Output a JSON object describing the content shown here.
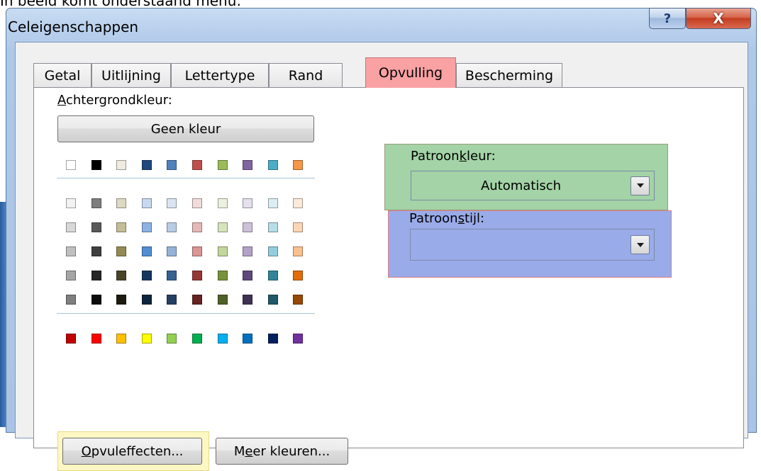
{
  "caption": "In beeld komt onderstaand menu:",
  "window": {
    "title": "Celeigenschappen",
    "help_label": "?",
    "close_label": "X"
  },
  "tabs": [
    {
      "label": "Getal",
      "active": false
    },
    {
      "label": "Uitlijning",
      "active": false
    },
    {
      "label": "Lettertype",
      "active": false
    },
    {
      "label": "Rand",
      "active": false
    },
    {
      "label": "Opvulling",
      "active": true
    },
    {
      "label": "Bescherming",
      "active": false
    }
  ],
  "background": {
    "label_accel": "A",
    "label_rest": "chtergrondkleur:",
    "no_color_button": "Geen kleur",
    "palette_top": [
      "#ffffff",
      "#000000",
      "#eeece1",
      "#1f497d",
      "#4f81bd",
      "#c0504d",
      "#9bbb59",
      "#8064a2",
      "#4bacc6",
      "#f79646"
    ],
    "palette_tints": [
      [
        "#f2f2f2",
        "#7f7f7f",
        "#ddd9c3",
        "#c6d9f0",
        "#dbe5f1",
        "#f2dcdb",
        "#ebf1dd",
        "#e5e0ec",
        "#dbeef3",
        "#fdeada"
      ],
      [
        "#d8d8d8",
        "#595959",
        "#c4bd97",
        "#8db3e2",
        "#b8cce4",
        "#e5b9b7",
        "#d7e3bc",
        "#ccc1d9",
        "#b7dde8",
        "#fbd5b5"
      ],
      [
        "#bfbfbf",
        "#3f3f3f",
        "#938953",
        "#548dd4",
        "#95b3d7",
        "#d99694",
        "#c3d69b",
        "#b2a2c7",
        "#92cddc",
        "#fac08f"
      ],
      [
        "#a5a5a5",
        "#262626",
        "#494429",
        "#17365d",
        "#366092",
        "#953734",
        "#76923c",
        "#5f497a",
        "#31859b",
        "#e36c09"
      ],
      [
        "#7f7f7f",
        "#0c0c0c",
        "#1d1b10",
        "#0f243e",
        "#244061",
        "#632423",
        "#4f6128",
        "#3f3151",
        "#205867",
        "#974806"
      ]
    ],
    "palette_standard": [
      "#c00000",
      "#ff0000",
      "#ffc000",
      "#ffff00",
      "#92d050",
      "#00b050",
      "#00b0f0",
      "#0070c0",
      "#002060",
      "#7030a0"
    ]
  },
  "buttons": {
    "fill_effects_accel": "O",
    "fill_effects_rest": "pvuleffecten...",
    "more_colors_pre": "M",
    "more_colors_accel": "e",
    "more_colors_rest": "er kleuren..."
  },
  "pattern_color": {
    "label_pre": "Patroon",
    "label_accel": "k",
    "label_rest": "leur:",
    "value": "Automatisch"
  },
  "pattern_style": {
    "label_pre": "Patroon",
    "label_accel": "s",
    "label_rest": "tijl:",
    "value": ""
  },
  "colors": {
    "active_tab_highlight": "#f9a1a3",
    "pattern_color_highlight": "#a3d3a6",
    "pattern_style_highlight": "#9aabe9",
    "fill_effects_highlight": "#fdf7c3"
  }
}
